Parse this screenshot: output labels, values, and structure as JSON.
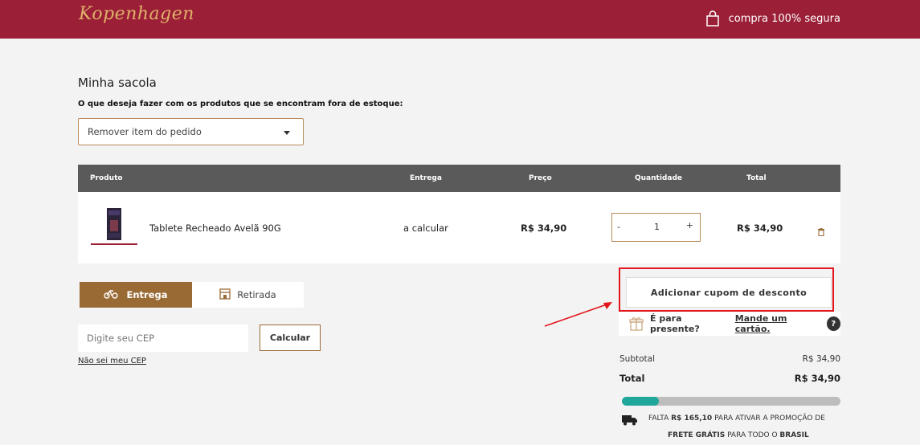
{
  "header": {
    "logo_text": "Kopenhagen",
    "secure_label": "compra 100% segura",
    "bg_color": "#9b1f36"
  },
  "cart": {
    "title": "Minha sacola",
    "stock_question": "O que deseja fazer com os produtos que se encontram fora de estoque:",
    "stock_option_selected": "Remover item do pedido",
    "columns": [
      "Produto",
      "Entrega",
      "Preço",
      "Quantidade",
      "Total"
    ],
    "items": [
      {
        "name": "Tablete Recheado Avelã 90G",
        "delivery": "a calcular",
        "price": "R$ 34,90",
        "quantity": "1",
        "minus_label": "-",
        "plus_label": "+",
        "total": "R$ 34,90",
        "remove_icon": "trash-icon"
      }
    ]
  },
  "shipping": {
    "tab_delivery": "Entrega",
    "tab_pickup": "Retirada",
    "cep_placeholder": "Digite seu CEP",
    "calc_button": "Calcular",
    "no_cep_link": "Não sei meu CEP"
  },
  "summary": {
    "coupon_button": "Adicionar cupom de desconto",
    "gift_question": "É para presente?",
    "gift_link": "Mande um cartão.",
    "help_label": "?",
    "subtotal_label": "Subtotal",
    "subtotal_value": "R$ 34,90",
    "total_label": "Total",
    "total_value": "R$ 34,90",
    "free_shipping_progress": 0.17,
    "promo_prefix": "FALTA",
    "promo_amount": "R$ 165,10",
    "promo_mid": "PARA ATIVAR A PROMOÇÃO DE",
    "promo_free": "FRETE GRÁTIS",
    "promo_for": "PARA TODO O",
    "promo_brasil": "BRASIL",
    "accent_color": "#9a6a34",
    "progress_color": "#1ea79a"
  }
}
